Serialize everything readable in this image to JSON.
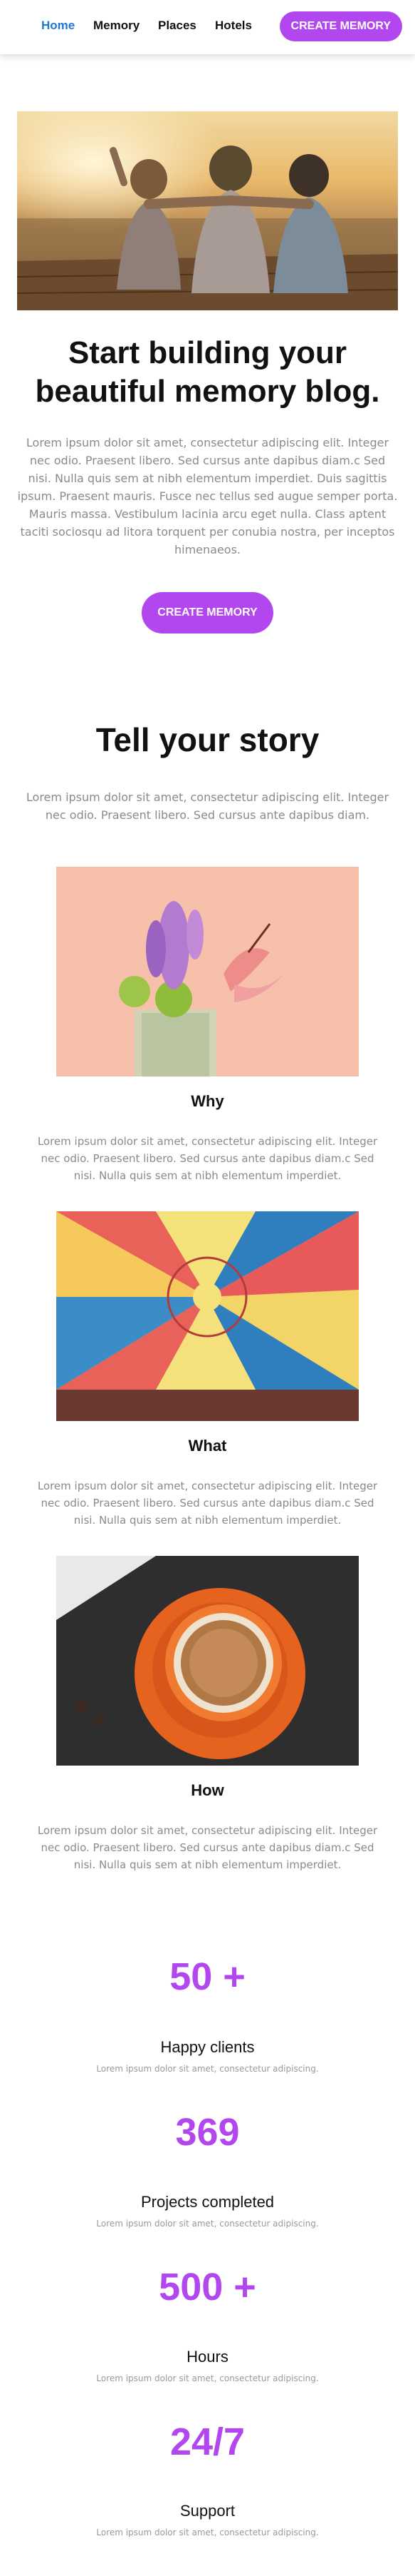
{
  "nav": {
    "items": [
      "Home",
      "Memory",
      "Places",
      "Hotels"
    ],
    "cta": "CREATE MEMORY"
  },
  "hero": {
    "title_line1": "Start building your",
    "title_line2": "beautiful memory blog.",
    "text": "Lorem ipsum dolor sit amet, consectetur adipiscing elit. Integer nec odio. Praesent libero. Sed cursus ante dapibus diam.c Sed nisi. Nulla quis sem at nibh elementum imperdiet. Duis sagittis ipsum. Praesent mauris. Fusce nec tellus sed augue semper porta. Mauris massa. Vestibulum lacinia arcu eget nulla. Class aptent taciti sociosqu ad litora torquent per conubia nostra, per inceptos himenaeos.",
    "button": "CREATE MEMORY"
  },
  "story": {
    "title": "Tell your story",
    "text": "Lorem ipsum dolor sit amet, consectetur adipiscing elit. Integer nec odio. Praesent libero. Sed cursus ante dapibus diam."
  },
  "cards": [
    {
      "title": "Why",
      "text": "Lorem ipsum dolor sit amet, consectetur adipiscing elit. Integer nec odio. Praesent libero. Sed cursus ante dapibus diam.c Sed nisi. Nulla quis sem at nibh elementum imperdiet."
    },
    {
      "title": "What",
      "text": "Lorem ipsum dolor sit amet, consectetur adipiscing elit. Integer nec odio. Praesent libero. Sed cursus ante dapibus diam.c Sed nisi. Nulla quis sem at nibh elementum imperdiet."
    },
    {
      "title": "How",
      "text": "Lorem ipsum dolor sit amet, consectetur adipiscing elit. Integer nec odio. Praesent libero. Sed cursus ante dapibus diam.c Sed nisi. Nulla quis sem at nibh elementum imperdiet."
    }
  ],
  "stats": [
    {
      "value": "50 +",
      "label": "Happy clients",
      "sub": "Lorem ipsum dolor sit amet, consectetur adipiscing."
    },
    {
      "value": "369",
      "label": "Projects completed",
      "sub": "Lorem ipsum dolor sit amet, consectetur adipiscing."
    },
    {
      "value": "500 +",
      "label": "Hours",
      "sub": "Lorem ipsum dolor sit amet, consectetur adipiscing."
    },
    {
      "value": "24/7",
      "label": "Support",
      "sub": "Lorem ipsum dolor sit amet, consectetur adipiscing."
    }
  ],
  "colors": {
    "accent": "#b347ef",
    "nav_active": "#1f78d1",
    "muted_text": "#8a8a8a"
  }
}
